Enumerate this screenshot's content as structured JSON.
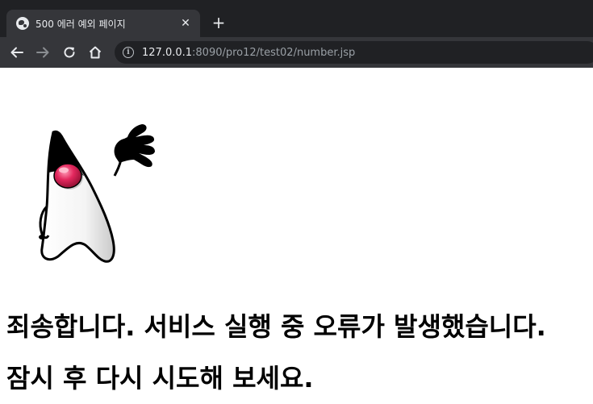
{
  "browser": {
    "tab": {
      "title": "500 에러 예외 페이지",
      "favicon": "globe-icon"
    },
    "new_tab_symbol": "+",
    "close_symbol": "✕",
    "address": {
      "host": "127.0.0.1",
      "rest": ":8090/pro12/test02/number.jsp"
    }
  },
  "page": {
    "image": "java-duke-mascot",
    "message_line1": "죄송합니다. 서비스 실행 중 오류가 발생했습니다.",
    "message_line2": "잠시 후 다시 시도해 보세요."
  },
  "colors": {
    "chrome_dark": "#202124",
    "chrome_tab": "#35363a",
    "duke_nose": "#e3285e"
  }
}
